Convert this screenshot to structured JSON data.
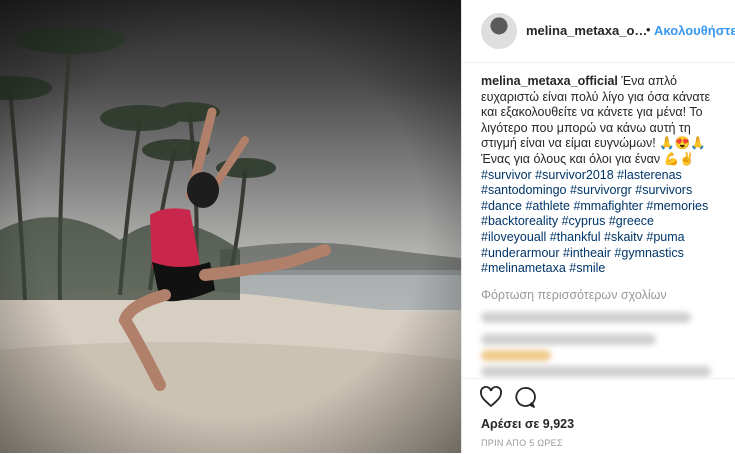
{
  "post": {
    "username": "melina_metaxa_official",
    "username_header": "melina_metaxa_offi…",
    "dot": "•",
    "follow_label": "Ακολουθήστε",
    "caption_text": " Ένα απλό ευχαριστώ είναι πολύ λίγο για όσα κάνατε και εξακολουθείτε να κάνετε για μένα! Το λιγότερο που μπορώ να κάνω αυτή τη στιγμή είναι να είμαι ευγνώμων! 🙏😍🙏 Ένας για όλους και όλοι για έναν 💪✌️",
    "hashtags": "#survivor #survivor2018 #lasterenas #santodomingo #survivorgr #survivors #dance #athlete #mmafighter #memories #backtoreality #cyprus #greece #iloveyouall #thankful #skaitv #puma #underarmour #intheair #gymnastics #melinametaxa #smile",
    "load_more": "Φόρτωση περισσότερων σχολίων",
    "likes_text": "Αρέσει σε 9,923",
    "time_ago": "ΠΡΙΝ ΑΠΟ 5 ΩΡΕΣ"
  },
  "icons": {
    "like": "heart-icon",
    "comment": "comment-bubble-icon"
  },
  "colors": {
    "link": "#3897f0",
    "hashtag": "#003569",
    "text": "#262626",
    "muted": "#999999"
  }
}
